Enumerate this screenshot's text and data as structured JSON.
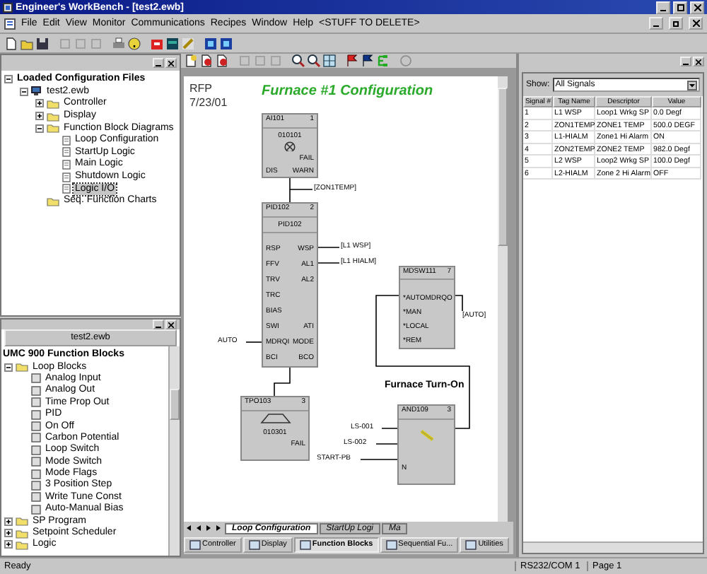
{
  "window": {
    "title": "Engineer's WorkBench - [test2.ewb]"
  },
  "menu": [
    "File",
    "Edit",
    "View",
    "Monitor",
    "Communications",
    "Recipes",
    "Window",
    "Help",
    "<STUFF TO DELETE>"
  ],
  "config_panel": {
    "tree": [
      {
        "label": "Loaded Configuration Files",
        "kind": "root",
        "expanded": true,
        "children": [
          {
            "label": "test2.ewb",
            "kind": "file",
            "expanded": true,
            "children": [
              {
                "label": "Controller",
                "kind": "folder",
                "expanded": false
              },
              {
                "label": "Display",
                "kind": "folder",
                "expanded": false
              },
              {
                "label": "Function Block Diagrams",
                "kind": "folder",
                "expanded": true,
                "children": [
                  {
                    "label": "Loop Configuration",
                    "kind": "doc",
                    "selected": false
                  },
                  {
                    "label": "StartUp Logic",
                    "kind": "doc",
                    "selected": false
                  },
                  {
                    "label": "Main Logic",
                    "kind": "doc",
                    "selected": false
                  },
                  {
                    "label": "Shutdown Logic",
                    "kind": "doc",
                    "selected": false
                  },
                  {
                    "label": "Logic I/O",
                    "kind": "doc",
                    "selected": true
                  }
                ]
              },
              {
                "label": "Seq. Function Charts",
                "kind": "folder"
              }
            ]
          }
        ]
      }
    ]
  },
  "blocks_panel": {
    "header": "test2.ewb",
    "title": "UMC 900 Function Blocks",
    "tree": [
      {
        "label": "Loop Blocks",
        "kind": "folder",
        "expanded": true,
        "children": [
          {
            "label": "Analog Input",
            "kind": "doc",
            "selected": false
          },
          {
            "label": "Analog Out",
            "kind": "doc",
            "selected": false
          },
          {
            "label": "Time Prop Out",
            "kind": "doc",
            "selected": false
          },
          {
            "label": "PID",
            "kind": "doc",
            "selected": false
          },
          {
            "label": "On Off",
            "kind": "doc",
            "selected": false
          },
          {
            "label": "Carbon Potential",
            "kind": "doc",
            "selected": false
          },
          {
            "label": "Loop Switch",
            "kind": "doc",
            "selected": false
          },
          {
            "label": "Mode Switch",
            "kind": "doc",
            "selected": false
          },
          {
            "label": "Mode Flags",
            "kind": "doc",
            "selected": false
          },
          {
            "label": "3 Position Step",
            "kind": "doc",
            "selected": false
          },
          {
            "label": "Write Tune Const",
            "kind": "doc",
            "selected": false
          },
          {
            "label": "Auto-Manual Bias",
            "kind": "doc",
            "selected": false
          }
        ]
      },
      {
        "label": "SP Program",
        "kind": "folder",
        "expanded": false
      },
      {
        "label": "Setpoint Scheduler",
        "kind": "folder",
        "expanded": false
      },
      {
        "label": "Logic",
        "kind": "folder",
        "expanded": false
      }
    ]
  },
  "diagram": {
    "author": "RFP",
    "date": "7/23/01",
    "title": "Furnace #1 Configuration",
    "subtitle": "Furnace Turn-On",
    "blocks": [
      {
        "kind": "ai",
        "name": "AI101",
        "number": "1",
        "code": "010101",
        "rows": [
          {
            "out": "FAIL"
          },
          {
            "in": "DIS",
            "out": "WARN"
          }
        ]
      },
      {
        "kind": "pid",
        "name": "PID102",
        "number": "2",
        "subtitle": "PID102",
        "rows": [
          {
            "in": "RSP",
            "out": "WSP"
          },
          {
            "in": "FFV",
            "out": "AL1"
          },
          {
            "in": "TRV",
            "out": "AL2"
          },
          {
            "in": "TRC"
          },
          {
            "in": "BIAS"
          },
          {
            "in": "SWI",
            "out": "ATI"
          },
          {
            "in": "MDRQI",
            "out": "MODE"
          },
          {
            "in": "BCI",
            "out": "BCO"
          }
        ]
      },
      {
        "kind": "switch",
        "name": "MDSW111",
        "number": "7",
        "rows": [
          {
            "in": "*AUTO",
            "out": "MDRQO"
          },
          {
            "in": "*MAN"
          },
          {
            "in": "*LOCAL"
          },
          {
            "in": "*REM"
          }
        ]
      },
      {
        "kind": "tpo",
        "name": "TPO103",
        "number": "3",
        "code": "010301",
        "rows": [
          {
            "out": "FAIL"
          }
        ]
      },
      {
        "kind": "and",
        "name": "AND109",
        "number": "3",
        "rows": [
          {
            "in": "N"
          }
        ]
      }
    ],
    "tags": [
      "[ZON1TEMP]",
      "[L1 WSP]",
      "[L1 HIALM]",
      "AUTO",
      "[AUTO]",
      "LS-001",
      "LS-002",
      "START-PB"
    ]
  },
  "sheet_tabs": [
    {
      "label": "Loop Configuration",
      "selected": true
    },
    {
      "label": "StartUp Logi",
      "selected": false
    },
    {
      "label": "Ma",
      "selected": false
    }
  ],
  "view_tabs": [
    {
      "label": "Controller",
      "selected": false
    },
    {
      "label": "Display",
      "selected": false
    },
    {
      "label": "Function Blocks",
      "selected": true
    },
    {
      "label": "Sequential Fu...",
      "selected": false
    },
    {
      "label": "Utilities",
      "selected": false
    }
  ],
  "signals": {
    "show_label": "Show:",
    "filter": "All Signals",
    "columns": [
      "Signal #",
      "Tag Name",
      "Descriptor",
      "Value"
    ],
    "rows": [
      [
        "1",
        "L1 WSP",
        "Loop1 Wrkg SP",
        "0.0 Degf"
      ],
      [
        "2",
        "ZON1TEMP",
        "ZONE1 TEMP",
        "500.0 DEGF"
      ],
      [
        "3",
        "L1-HIALM",
        "Zone1 Hi Alarm",
        "ON"
      ],
      [
        "4",
        "ZON2TEMP",
        "ZONE2 TEMP",
        "982.0 Degf"
      ],
      [
        "5",
        "L2 WSP",
        "Loop2 Wrkg SP",
        "100.0 Degf"
      ],
      [
        "6",
        "L2-HIALM",
        "Zone 2 Hi Alarm",
        "OFF"
      ]
    ]
  },
  "status_bar": [
    "Ready",
    "RS232/COM 1",
    "Page 1"
  ]
}
